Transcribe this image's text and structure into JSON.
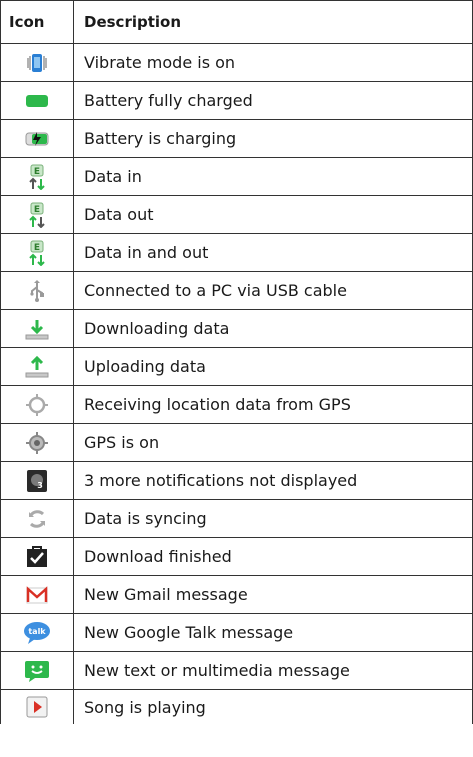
{
  "table": {
    "header": {
      "icon": "Icon",
      "description": "Description"
    },
    "rows": [
      {
        "icon": "vibrate-icon",
        "description": "Vibrate mode is on"
      },
      {
        "icon": "battery-full-icon",
        "description": "Battery fully charged"
      },
      {
        "icon": "battery-charging-icon",
        "description": "Battery is charging"
      },
      {
        "icon": "data-in-icon",
        "description": "Data in"
      },
      {
        "icon": "data-out-icon",
        "description": "Data out"
      },
      {
        "icon": "data-in-out-icon",
        "description": "Data in and out"
      },
      {
        "icon": "usb-icon",
        "description": "Connected to a PC via USB cable"
      },
      {
        "icon": "download-icon",
        "description": "Downloading data"
      },
      {
        "icon": "upload-icon",
        "description": "Uploading data"
      },
      {
        "icon": "gps-receiving-icon",
        "description": "Receiving location data from GPS"
      },
      {
        "icon": "gps-on-icon",
        "description": "GPS is on"
      },
      {
        "icon": "more-notifications-icon",
        "description": "3 more notifications not displayed",
        "badge": "3"
      },
      {
        "icon": "sync-icon",
        "description": "Data is syncing"
      },
      {
        "icon": "download-finished-icon",
        "description": "Download finished"
      },
      {
        "icon": "gmail-icon",
        "description": "New Gmail message"
      },
      {
        "icon": "google-talk-icon",
        "description": "New Google Talk message",
        "badge": "talk"
      },
      {
        "icon": "text-message-icon",
        "description": "New text or multimedia message"
      },
      {
        "icon": "song-playing-icon",
        "description": "Song is playing"
      }
    ]
  },
  "colors": {
    "green": "#2db84b",
    "red": "#d93025",
    "blue": "#2a7fd4",
    "grey": "#9a9a9a"
  }
}
